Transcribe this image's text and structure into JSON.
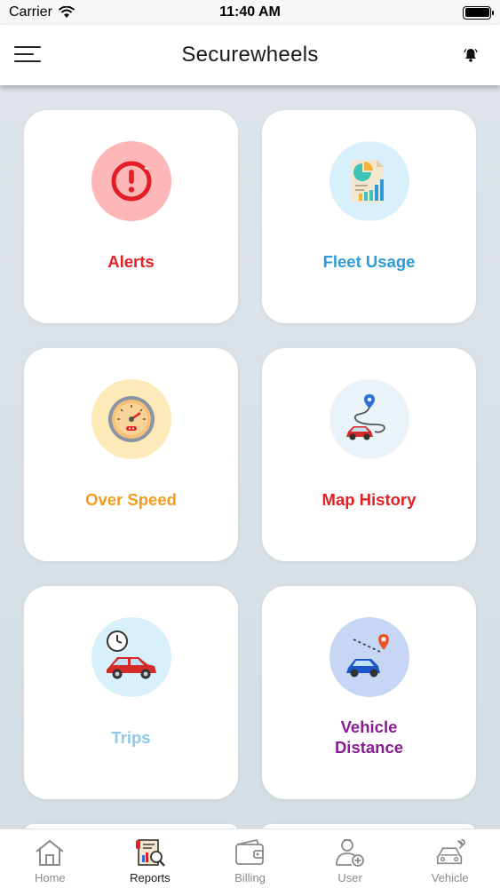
{
  "status_bar": {
    "carrier": "Carrier",
    "time": "11:40 AM"
  },
  "header": {
    "title": "Securewheels"
  },
  "colors": {
    "alerts": "#e21f26",
    "fleet": "#2d9ad9",
    "overspeed": "#f39c1e",
    "map_history": "#e21f26",
    "trips": "#8cc9ea",
    "vehicle_distance": "#8a1c91"
  },
  "cards": [
    {
      "label": "Alerts",
      "icon": "alert-exclamation-icon"
    },
    {
      "label": "Fleet Usage",
      "icon": "fleet-usage-chart-icon"
    },
    {
      "label": "Over Speed",
      "icon": "speedometer-icon"
    },
    {
      "label": "Map History",
      "icon": "map-route-icon"
    },
    {
      "label": "Trips",
      "icon": "trip-clock-car-icon"
    },
    {
      "label": "Vehicle Distance",
      "line1": "Vehicle",
      "line2": "Distance",
      "icon": "vehicle-distance-icon"
    }
  ],
  "tabs": [
    {
      "label": "Home",
      "icon": "home-icon",
      "active": false
    },
    {
      "label": "Reports",
      "icon": "reports-icon",
      "active": true
    },
    {
      "label": "Billing",
      "icon": "wallet-icon",
      "active": false
    },
    {
      "label": "User",
      "icon": "user-add-icon",
      "active": false
    },
    {
      "label": "Vehicle",
      "icon": "car-wrench-icon",
      "active": false
    }
  ]
}
